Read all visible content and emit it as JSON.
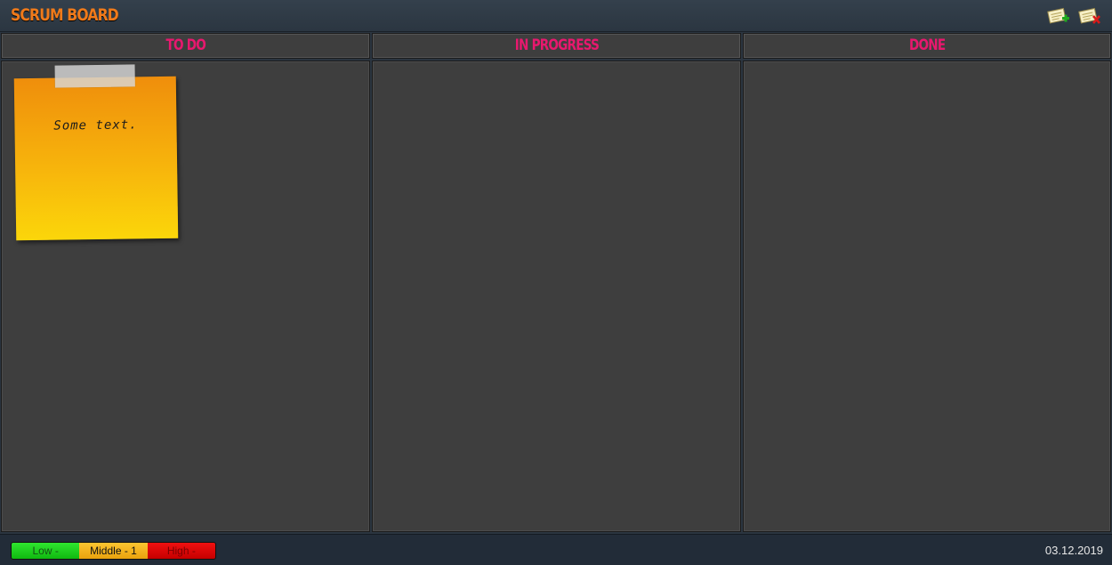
{
  "app": {
    "title": "SCRUM BOARD"
  },
  "toolbar": {
    "add_icon": "add-note-icon",
    "delete_icon": "delete-note-icon"
  },
  "columns": [
    {
      "title": "TO DO"
    },
    {
      "title": "IN PROGRESS"
    },
    {
      "title": "DONE"
    }
  ],
  "notes": [
    {
      "text": "Some text.",
      "column": "TO DO",
      "color": "#f7b40c"
    }
  ],
  "footer": {
    "priorities": [
      {
        "label": "Low -",
        "color": "#1fd01f"
      },
      {
        "label": "Middle - 1",
        "color": "#f5b41e"
      },
      {
        "label": "High -",
        "color": "#e00808"
      }
    ],
    "date": "03.12.2019"
  },
  "colors": {
    "title": "#f07a1a",
    "column_header": "#e8186e",
    "board_bg": "#3e3e3e",
    "chrome_bg": "#2b3540"
  }
}
